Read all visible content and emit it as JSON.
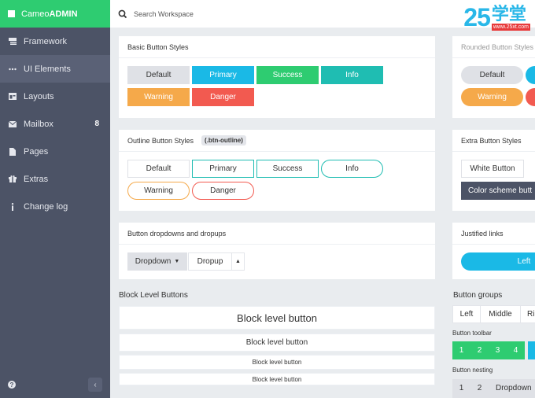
{
  "brand": {
    "prefix": "Cameo",
    "suffix": "ADMIN"
  },
  "search": {
    "placeholder": "Search Workspace"
  },
  "watermark": {
    "number": "25",
    "cn": "学堂",
    "url": "www.25xt.com"
  },
  "sidebar": {
    "items": [
      {
        "label": "Framework",
        "icon": "layers-icon"
      },
      {
        "label": "UI Elements",
        "icon": "dots-icon"
      },
      {
        "label": "Layouts",
        "icon": "layout-icon"
      },
      {
        "label": "Mailbox",
        "icon": "mail-icon",
        "badge": "8"
      },
      {
        "label": "Pages",
        "icon": "page-icon"
      },
      {
        "label": "Extras",
        "icon": "gift-icon"
      },
      {
        "label": "Change log",
        "icon": "info-icon"
      }
    ],
    "help": "?",
    "collapse": "‹"
  },
  "basic": {
    "title": "Basic Button Styles",
    "buttons": [
      "Default",
      "Primary",
      "Success",
      "Info",
      "Warning",
      "Danger"
    ]
  },
  "rounded": {
    "title": "Rounded Button Styles",
    "buttons": [
      "Default",
      "Warning"
    ]
  },
  "outline": {
    "title": "Outline Button Styles",
    "tag": "(.btn-outline)",
    "buttons": [
      "Default",
      "Primary",
      "Success",
      "Info",
      "Warning",
      "Danger"
    ]
  },
  "extra": {
    "title": "Extra Button Styles",
    "buttons": [
      "White Button",
      "Color scheme butt"
    ]
  },
  "dropdowns": {
    "title": "Button dropdowns and dropups",
    "dropdown": "Dropdown",
    "dropup": "Dropup"
  },
  "justified": {
    "title": "Justified links",
    "left": "Left"
  },
  "block": {
    "title": "Block Level Buttons",
    "buttons": [
      "Block level button",
      "Block level button",
      "Block level button",
      "Block level button"
    ]
  },
  "groups": {
    "title": "Button groups",
    "items": [
      "Left",
      "Middle",
      "Ri"
    ],
    "toolbar_label": "Button toolbar",
    "toolbar": [
      "1",
      "2",
      "3",
      "4"
    ],
    "nesting_label": "Button nesting",
    "nesting": [
      "1",
      "2",
      "Dropdown"
    ]
  },
  "colors": {
    "sidebar": "#4c5366",
    "brand": "#2ecc71",
    "primary": "#1ab9e6",
    "success": "#2ecc71",
    "info": "#1fbdb2",
    "warning": "#f5a94a",
    "danger": "#f25a50"
  }
}
